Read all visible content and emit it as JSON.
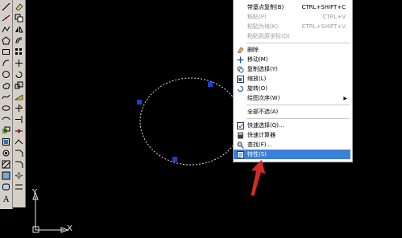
{
  "context_menu": {
    "items": [
      {
        "label": "带基点复制(B)",
        "shortcut": "CTRL+SHIFT+C",
        "enabled": true,
        "icon": "copy-base-icon"
      },
      {
        "label": "粘贴(P)",
        "shortcut": "CTRL+V",
        "enabled": false,
        "icon": "paste-icon"
      },
      {
        "label": "粘贴为块(K)",
        "shortcut": "CTRL+SHIFT+V",
        "enabled": false,
        "icon": "paste-block-icon"
      },
      {
        "label": "粘贴到原坐标(D)",
        "shortcut": "",
        "enabled": false,
        "icon": "paste-orig-icon"
      },
      {
        "label": "删除",
        "shortcut": "",
        "enabled": true,
        "icon": "eraser-icon"
      },
      {
        "label": "移动(M)",
        "shortcut": "",
        "enabled": true,
        "icon": "move-icon"
      },
      {
        "label": "复制选择(Y)",
        "shortcut": "",
        "enabled": true,
        "icon": "copy-select-icon"
      },
      {
        "label": "缩放(L)",
        "shortcut": "",
        "enabled": true,
        "icon": "scale-icon"
      },
      {
        "label": "旋转(O)",
        "shortcut": "",
        "enabled": true,
        "icon": "rotate-icon"
      },
      {
        "label": "绘图次序(W)",
        "shortcut": "",
        "enabled": true,
        "icon": "draw-order-icon",
        "submenu": true
      },
      {
        "label": "全部不选(A)",
        "shortcut": "",
        "enabled": true,
        "icon": "deselect-icon"
      },
      {
        "label": "快速选择(Q)...",
        "shortcut": "",
        "enabled": true,
        "icon": "quick-select-icon"
      },
      {
        "label": "快速计算器",
        "shortcut": "",
        "enabled": true,
        "icon": "calculator-icon"
      },
      {
        "label": "查找(F)...",
        "shortcut": "",
        "enabled": true,
        "icon": "find-icon"
      },
      {
        "label": "特性(S)",
        "shortcut": "",
        "enabled": true,
        "icon": "properties-icon",
        "selected": true
      }
    ]
  },
  "ucs": {
    "x_label": "X",
    "y_label": "Y"
  },
  "colors": {
    "highlight": "#3c7fd6",
    "grip": "#1b3fd6",
    "pointer": "#d42a2a",
    "canvas": "#000000"
  }
}
